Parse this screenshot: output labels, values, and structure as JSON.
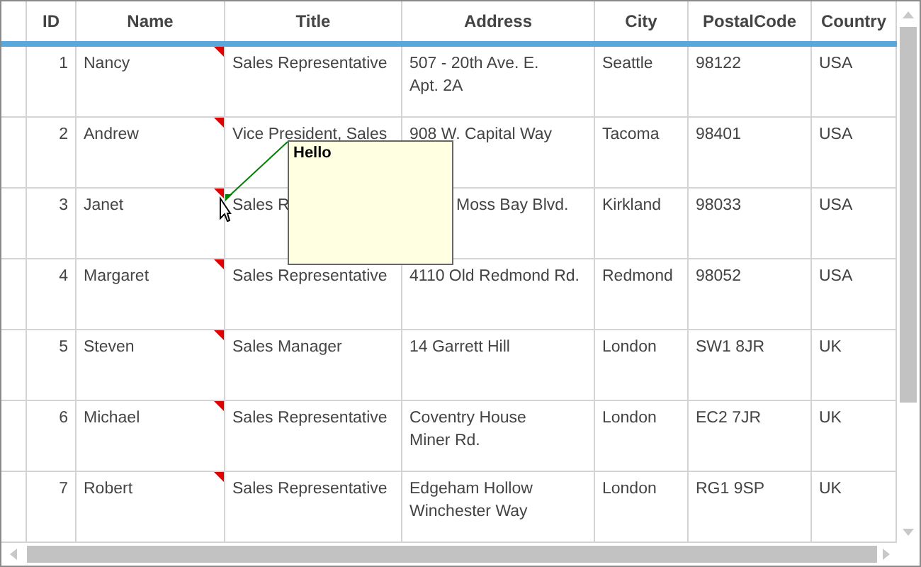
{
  "columns": [
    "ID",
    "Name",
    "Title",
    "Address",
    "City",
    "PostalCode",
    "Country"
  ],
  "rows": [
    {
      "cells": [
        "1",
        "Nancy",
        "Sales Representative",
        "507 - 20th Ave. E.\nApt. 2A",
        "Seattle",
        "98122",
        "USA"
      ],
      "note_marker": true
    },
    {
      "cells": [
        "2",
        "Andrew",
        "Vice President, Sales",
        "908 W. Capital Way",
        "Tacoma",
        "98401",
        "USA"
      ],
      "note_marker": true
    },
    {
      "cells": [
        "3",
        "Janet",
        "Sales R",
        "Moss Bay Blvd.",
        "Kirkland",
        "98033",
        "USA"
      ],
      "note_marker": true,
      "comment": {
        "text": "Hello"
      }
    },
    {
      "cells": [
        "4",
        "Margaret",
        "Sales Representative",
        "4110 Old Redmond Rd.",
        "Redmond",
        "98052",
        "USA"
      ],
      "note_marker": true
    },
    {
      "cells": [
        "5",
        "Steven",
        "Sales Manager",
        "14 Garrett Hill",
        "London",
        "SW1 8JR",
        "UK"
      ],
      "note_marker": true
    },
    {
      "cells": [
        "6",
        "Michael",
        "Sales Representative",
        "Coventry House\nMiner Rd.",
        "London",
        "EC2 7JR",
        "UK"
      ],
      "note_marker": true
    },
    {
      "cells": [
        "7",
        "Robert",
        "Sales Representative",
        "Edgeham Hollow\nWinchester Way",
        "London",
        "RG1 9SP",
        "UK"
      ],
      "note_marker": true
    }
  ]
}
